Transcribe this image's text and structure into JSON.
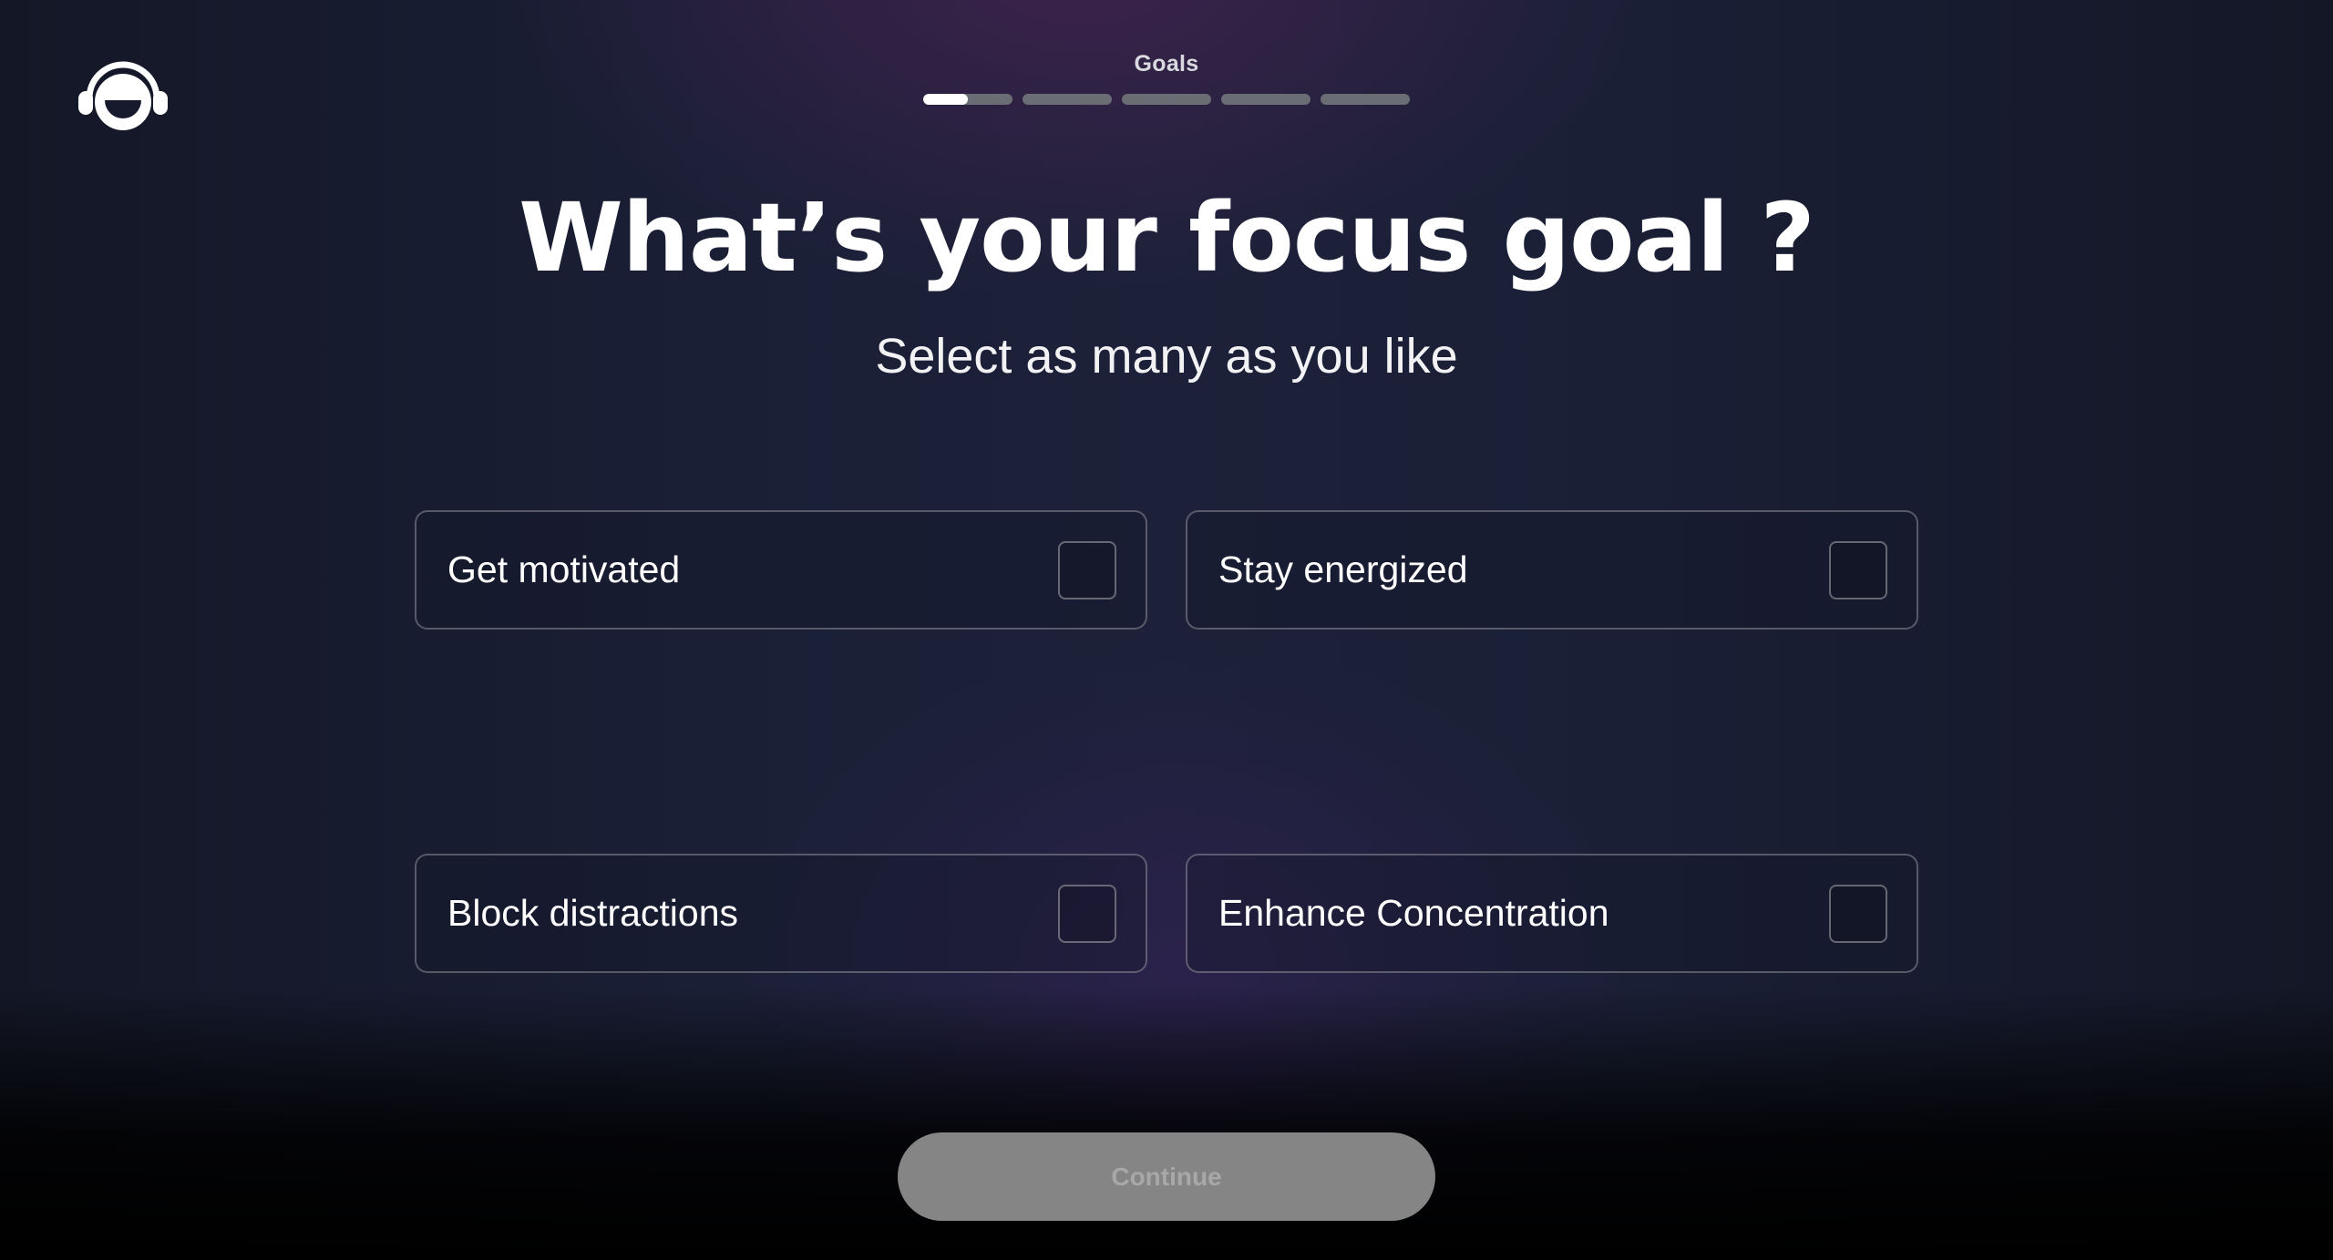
{
  "header": {
    "logo_icon": "headphones-smiley-logo-icon",
    "step_label": "Goals",
    "steps": [
      {
        "progress": 0.5
      },
      {
        "progress": 0
      },
      {
        "progress": 0
      },
      {
        "progress": 0
      },
      {
        "progress": 0
      }
    ]
  },
  "main": {
    "title": "What’s your focus goal ?",
    "subtitle": "Select as many as you like",
    "options": [
      {
        "label": "Get motivated",
        "checked": false
      },
      {
        "label": "Stay energized",
        "checked": false
      },
      {
        "label": "Block distractions",
        "checked": false
      },
      {
        "label": "Enhance Concentration",
        "checked": false
      }
    ]
  },
  "footer": {
    "continue_label": "Continue",
    "continue_state": "disabled"
  },
  "colors": {
    "background": "#1a1f36",
    "button_disabled": "#858585",
    "progress_active": "#ffffff",
    "progress_inactive": "#6b6d75"
  }
}
